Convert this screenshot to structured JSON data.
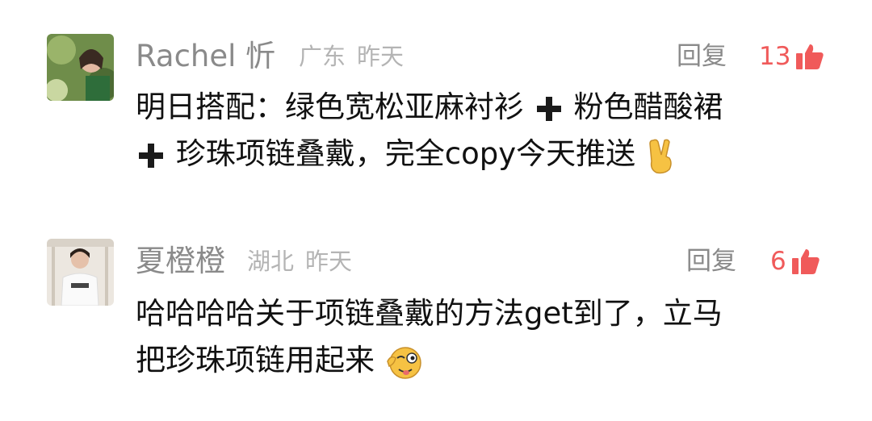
{
  "comments": [
    {
      "author": "Rachel 忻",
      "location": "广东",
      "time": "昨天",
      "reply_label": "回复",
      "likes": "13",
      "text_parts": [
        "明日搭配：绿色宽松亚麻衬衫",
        "粉色醋酸裙",
        "珍珠项链叠戴，完全copy今天推送"
      ],
      "icons": [
        "avatar-photo",
        "plus-icon",
        "plus-icon",
        "victory-hand-emoji-icon",
        "thumbs-up-icon"
      ]
    },
    {
      "author": "夏橙橙",
      "location": "湖北",
      "time": "昨天",
      "reply_label": "回复",
      "likes": "6",
      "text_parts": [
        "哈哈哈哈关于项链叠戴的方法get到了，立马",
        "把珍珠项链用起来"
      ],
      "icons": [
        "avatar-photo",
        "wink-tongue-emoji-icon",
        "thumbs-up-icon"
      ]
    }
  ],
  "colors": {
    "likes": "#f05a5a",
    "name": "#8a8a8a",
    "meta": "#b4b4b4",
    "text": "#111111"
  }
}
